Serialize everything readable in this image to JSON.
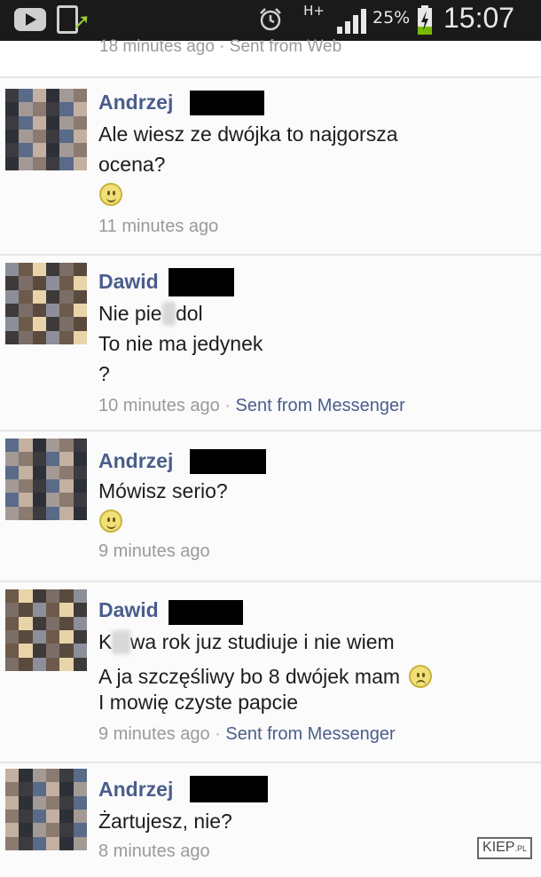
{
  "status_bar": {
    "network_type": "H+",
    "battery_percent": "25%",
    "time": "15:07",
    "icons": [
      "youtube-icon",
      "download-icon",
      "alarm-icon",
      "signal-icon",
      "battery-charging-icon"
    ]
  },
  "feed": {
    "previous_meta": "18 minutes ago · Sent from Web",
    "posts": [
      {
        "author": "Andrzej",
        "lines": [
          "Ale wiesz ze dwójka to najgorsza",
          "ocena?"
        ],
        "emoji": "smile-emoji-icon",
        "time": "11 minutes ago",
        "via": ""
      },
      {
        "author": "Dawid",
        "lines": [
          "Nie pie",
          "dol",
          "To nie ma jedynek",
          "?"
        ],
        "emoji": "",
        "time": "10 minutes ago",
        "via": "Sent from Messenger"
      },
      {
        "author": "Andrzej",
        "lines": [
          "Mówisz serio?"
        ],
        "emoji": "smile-emoji-icon",
        "time": "9 minutes ago",
        "via": ""
      },
      {
        "author": "Dawid",
        "lines": [
          "K",
          "wa rok juz studiuje i nie wiem",
          "A ja szczęśliwy bo 8 dwójek mam",
          "I mowię czyste papcie"
        ],
        "emoji": "sad-emoji-icon",
        "time": "9 minutes ago",
        "via": "Sent from Messenger"
      },
      {
        "author": "Andrzej",
        "lines": [
          "Żartujesz, nie?"
        ],
        "emoji": "",
        "time": "8 minutes ago",
        "via": ""
      }
    ]
  },
  "watermark": {
    "main": "KIEP",
    "suffix": ".PL"
  },
  "colors": {
    "author": "#4a5d8c",
    "meta": "#9a9a9a",
    "status_bar": "#1a1a1a",
    "divider": "#e4e6ea"
  }
}
